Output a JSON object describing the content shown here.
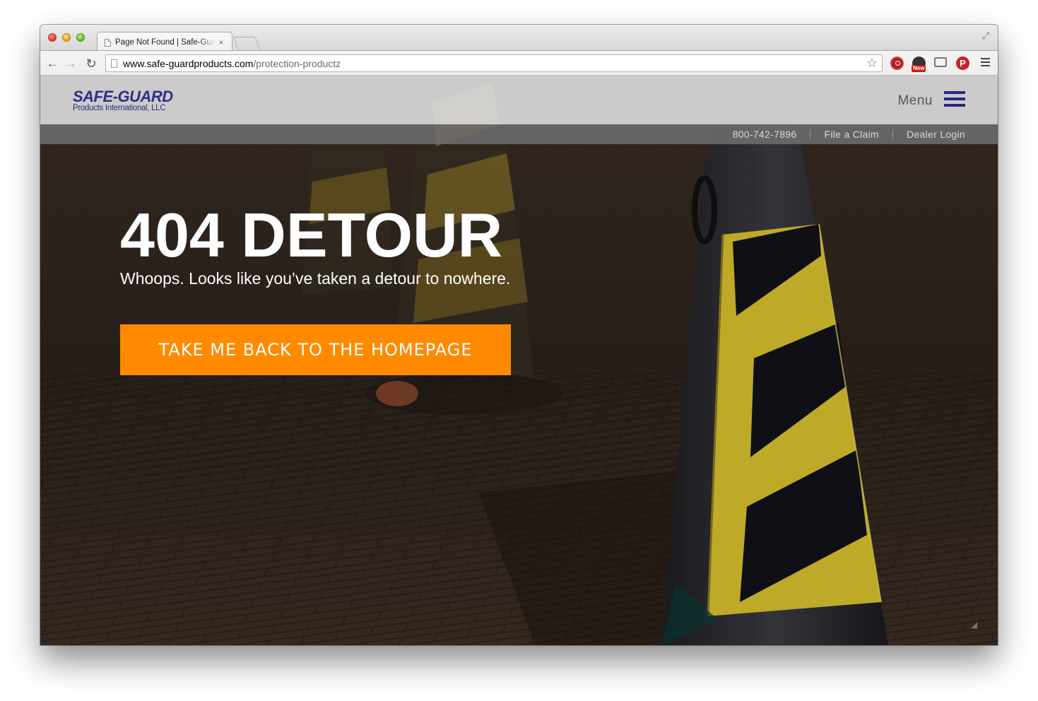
{
  "browser": {
    "tab_title": "Page Not Found | Safe-Guard",
    "tab_close": "×",
    "url_domain": "www.safe-guardproducts.com",
    "url_path": "/protection-productz",
    "extension_badge": "New",
    "pinterest_glyph": "P"
  },
  "site": {
    "logo_main": "SAFE-GUARD",
    "logo_sub": "Products International, LLC",
    "menu_label": "Menu",
    "utility_links": {
      "phone": "800-742-7896",
      "file_claim": "File a Claim",
      "dealer_login": "Dealer Login"
    }
  },
  "hero": {
    "title": "404 DETOUR",
    "subtitle": "Whoops. Looks like you’ve taken a detour to nowhere.",
    "cta_label": "TAKE ME BACK TO THE HOMEPAGE"
  },
  "colors": {
    "brand_navy": "#2b2f86",
    "cta_orange": "#ff8a00"
  }
}
